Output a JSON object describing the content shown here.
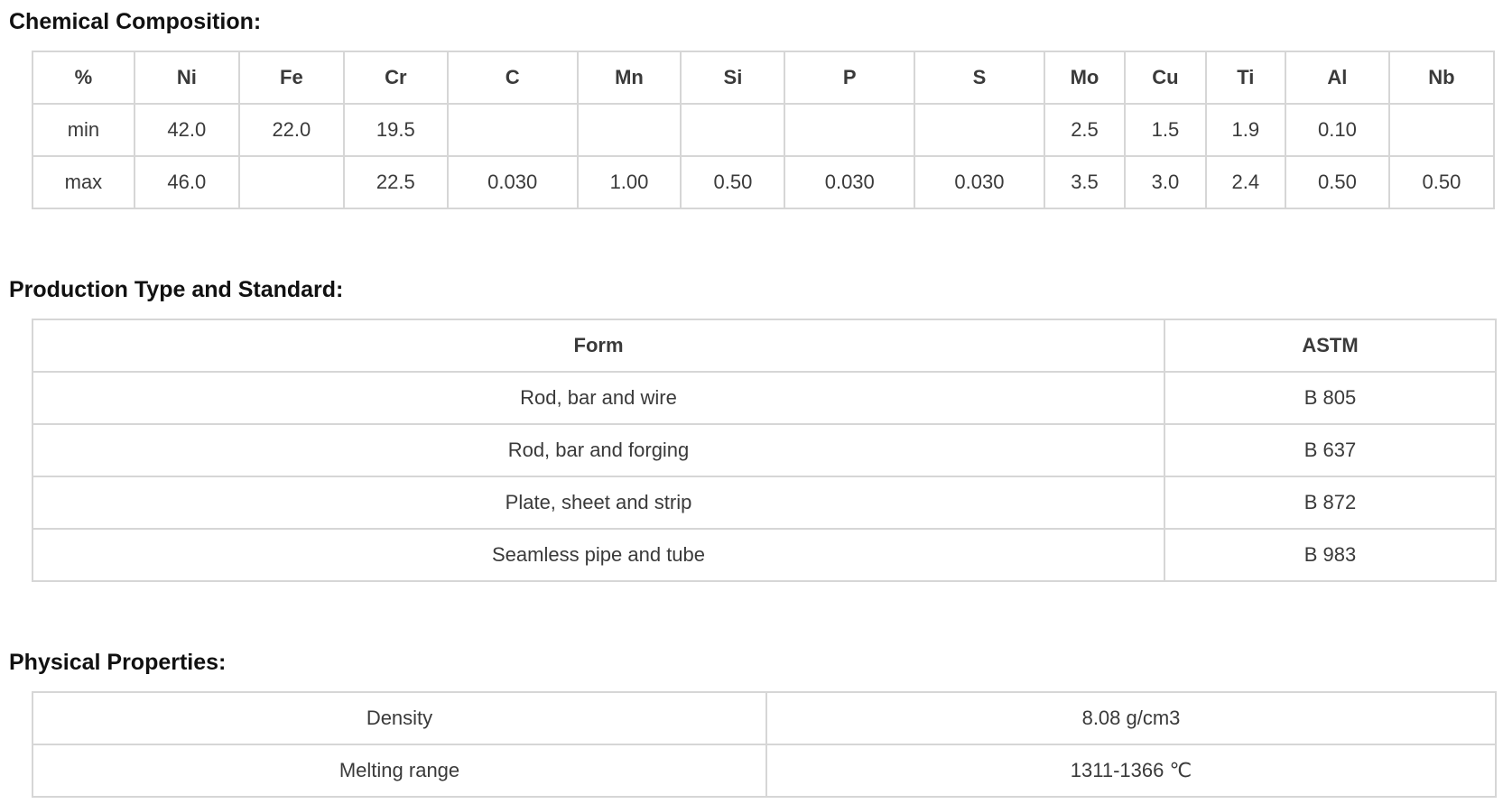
{
  "sections": {
    "chemical": {
      "title": "Chemical Composition:",
      "headers": [
        "%",
        "Ni",
        "Fe",
        "Cr",
        "C",
        "Mn",
        "Si",
        "P",
        "S",
        "Mo",
        "Cu",
        "Ti",
        "Al",
        "Nb"
      ],
      "rows": [
        [
          "min",
          "42.0",
          "22.0",
          "19.5",
          "",
          "",
          "",
          "",
          "",
          "2.5",
          "1.5",
          "1.9",
          "0.10",
          ""
        ],
        [
          "max",
          "46.0",
          "",
          "22.5",
          "0.030",
          "1.00",
          "0.50",
          "0.030",
          "0.030",
          "3.5",
          "3.0",
          "2.4",
          "0.50",
          "0.50"
        ]
      ]
    },
    "production": {
      "title": "Production Type and Standard:",
      "headers": [
        "Form",
        "ASTM"
      ],
      "rows": [
        [
          "Rod, bar and wire",
          "B 805"
        ],
        [
          "Rod, bar and forging",
          "B 637"
        ],
        [
          "Plate, sheet and strip",
          "B 872"
        ],
        [
          "Seamless pipe and tube",
          "B 983"
        ]
      ]
    },
    "physical": {
      "title": "Physical Properties:",
      "rows": [
        [
          "Density",
          "8.08 g/cm3"
        ],
        [
          "Melting range",
          "1311-1366 ℃"
        ]
      ]
    }
  }
}
